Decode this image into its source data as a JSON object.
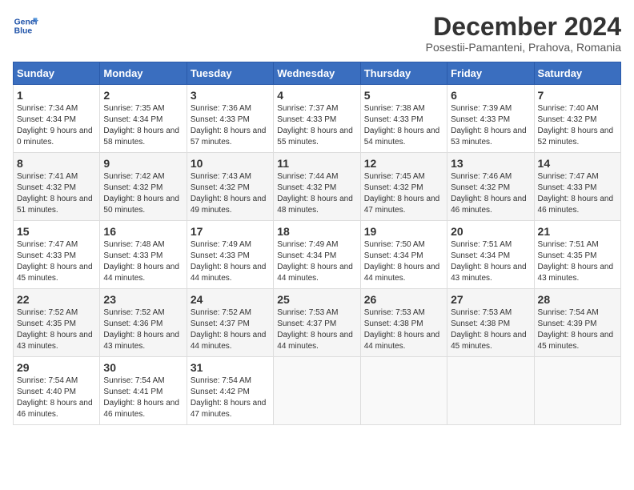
{
  "header": {
    "logo_line1": "General",
    "logo_line2": "Blue",
    "title": "December 2024",
    "subtitle": "Posestii-Pamanteni, Prahova, Romania"
  },
  "weekdays": [
    "Sunday",
    "Monday",
    "Tuesday",
    "Wednesday",
    "Thursday",
    "Friday",
    "Saturday"
  ],
  "weeks": [
    [
      {
        "day": "1",
        "sunrise": "Sunrise: 7:34 AM",
        "sunset": "Sunset: 4:34 PM",
        "daylight": "Daylight: 9 hours and 0 minutes."
      },
      {
        "day": "2",
        "sunrise": "Sunrise: 7:35 AM",
        "sunset": "Sunset: 4:34 PM",
        "daylight": "Daylight: 8 hours and 58 minutes."
      },
      {
        "day": "3",
        "sunrise": "Sunrise: 7:36 AM",
        "sunset": "Sunset: 4:33 PM",
        "daylight": "Daylight: 8 hours and 57 minutes."
      },
      {
        "day": "4",
        "sunrise": "Sunrise: 7:37 AM",
        "sunset": "Sunset: 4:33 PM",
        "daylight": "Daylight: 8 hours and 55 minutes."
      },
      {
        "day": "5",
        "sunrise": "Sunrise: 7:38 AM",
        "sunset": "Sunset: 4:33 PM",
        "daylight": "Daylight: 8 hours and 54 minutes."
      },
      {
        "day": "6",
        "sunrise": "Sunrise: 7:39 AM",
        "sunset": "Sunset: 4:33 PM",
        "daylight": "Daylight: 8 hours and 53 minutes."
      },
      {
        "day": "7",
        "sunrise": "Sunrise: 7:40 AM",
        "sunset": "Sunset: 4:32 PM",
        "daylight": "Daylight: 8 hours and 52 minutes."
      }
    ],
    [
      {
        "day": "8",
        "sunrise": "Sunrise: 7:41 AM",
        "sunset": "Sunset: 4:32 PM",
        "daylight": "Daylight: 8 hours and 51 minutes."
      },
      {
        "day": "9",
        "sunrise": "Sunrise: 7:42 AM",
        "sunset": "Sunset: 4:32 PM",
        "daylight": "Daylight: 8 hours and 50 minutes."
      },
      {
        "day": "10",
        "sunrise": "Sunrise: 7:43 AM",
        "sunset": "Sunset: 4:32 PM",
        "daylight": "Daylight: 8 hours and 49 minutes."
      },
      {
        "day": "11",
        "sunrise": "Sunrise: 7:44 AM",
        "sunset": "Sunset: 4:32 PM",
        "daylight": "Daylight: 8 hours and 48 minutes."
      },
      {
        "day": "12",
        "sunrise": "Sunrise: 7:45 AM",
        "sunset": "Sunset: 4:32 PM",
        "daylight": "Daylight: 8 hours and 47 minutes."
      },
      {
        "day": "13",
        "sunrise": "Sunrise: 7:46 AM",
        "sunset": "Sunset: 4:32 PM",
        "daylight": "Daylight: 8 hours and 46 minutes."
      },
      {
        "day": "14",
        "sunrise": "Sunrise: 7:47 AM",
        "sunset": "Sunset: 4:33 PM",
        "daylight": "Daylight: 8 hours and 46 minutes."
      }
    ],
    [
      {
        "day": "15",
        "sunrise": "Sunrise: 7:47 AM",
        "sunset": "Sunset: 4:33 PM",
        "daylight": "Daylight: 8 hours and 45 minutes."
      },
      {
        "day": "16",
        "sunrise": "Sunrise: 7:48 AM",
        "sunset": "Sunset: 4:33 PM",
        "daylight": "Daylight: 8 hours and 44 minutes."
      },
      {
        "day": "17",
        "sunrise": "Sunrise: 7:49 AM",
        "sunset": "Sunset: 4:33 PM",
        "daylight": "Daylight: 8 hours and 44 minutes."
      },
      {
        "day": "18",
        "sunrise": "Sunrise: 7:49 AM",
        "sunset": "Sunset: 4:34 PM",
        "daylight": "Daylight: 8 hours and 44 minutes."
      },
      {
        "day": "19",
        "sunrise": "Sunrise: 7:50 AM",
        "sunset": "Sunset: 4:34 PM",
        "daylight": "Daylight: 8 hours and 44 minutes."
      },
      {
        "day": "20",
        "sunrise": "Sunrise: 7:51 AM",
        "sunset": "Sunset: 4:34 PM",
        "daylight": "Daylight: 8 hours and 43 minutes."
      },
      {
        "day": "21",
        "sunrise": "Sunrise: 7:51 AM",
        "sunset": "Sunset: 4:35 PM",
        "daylight": "Daylight: 8 hours and 43 minutes."
      }
    ],
    [
      {
        "day": "22",
        "sunrise": "Sunrise: 7:52 AM",
        "sunset": "Sunset: 4:35 PM",
        "daylight": "Daylight: 8 hours and 43 minutes."
      },
      {
        "day": "23",
        "sunrise": "Sunrise: 7:52 AM",
        "sunset": "Sunset: 4:36 PM",
        "daylight": "Daylight: 8 hours and 43 minutes."
      },
      {
        "day": "24",
        "sunrise": "Sunrise: 7:52 AM",
        "sunset": "Sunset: 4:37 PM",
        "daylight": "Daylight: 8 hours and 44 minutes."
      },
      {
        "day": "25",
        "sunrise": "Sunrise: 7:53 AM",
        "sunset": "Sunset: 4:37 PM",
        "daylight": "Daylight: 8 hours and 44 minutes."
      },
      {
        "day": "26",
        "sunrise": "Sunrise: 7:53 AM",
        "sunset": "Sunset: 4:38 PM",
        "daylight": "Daylight: 8 hours and 44 minutes."
      },
      {
        "day": "27",
        "sunrise": "Sunrise: 7:53 AM",
        "sunset": "Sunset: 4:38 PM",
        "daylight": "Daylight: 8 hours and 45 minutes."
      },
      {
        "day": "28",
        "sunrise": "Sunrise: 7:54 AM",
        "sunset": "Sunset: 4:39 PM",
        "daylight": "Daylight: 8 hours and 45 minutes."
      }
    ],
    [
      {
        "day": "29",
        "sunrise": "Sunrise: 7:54 AM",
        "sunset": "Sunset: 4:40 PM",
        "daylight": "Daylight: 8 hours and 46 minutes."
      },
      {
        "day": "30",
        "sunrise": "Sunrise: 7:54 AM",
        "sunset": "Sunset: 4:41 PM",
        "daylight": "Daylight: 8 hours and 46 minutes."
      },
      {
        "day": "31",
        "sunrise": "Sunrise: 7:54 AM",
        "sunset": "Sunset: 4:42 PM",
        "daylight": "Daylight: 8 hours and 47 minutes."
      },
      null,
      null,
      null,
      null
    ]
  ]
}
